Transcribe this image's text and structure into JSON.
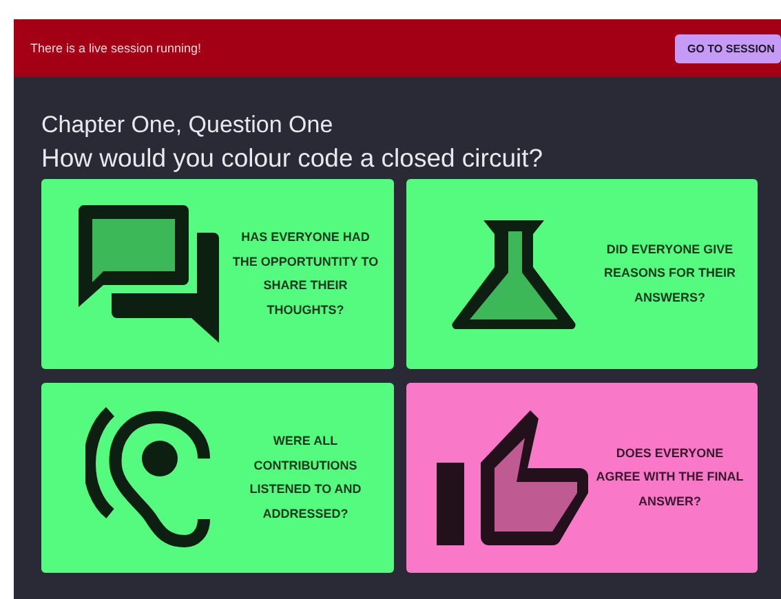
{
  "banner": {
    "message": "There is a live session running!",
    "button": "GO TO SESSION"
  },
  "chapter": "Chapter One, Question One",
  "question": "How would you colour code a closed circuit?",
  "cards": [
    {
      "kind": "chat",
      "color": "#55fb7e",
      "text": "HAS EVERYONE HAD THE OPPORTUNTITY TO SHARE THEIR THOUGHTS?"
    },
    {
      "kind": "flask",
      "color": "#55fb7e",
      "text": "DID EVERYONE GIVE REASONS FOR THEIR ANSWERS?"
    },
    {
      "kind": "ear",
      "color": "#55fb7e",
      "text": "WERE ALL CONTRIBUTIONS LISTENED TO AND ADDRESSED?"
    },
    {
      "kind": "thumb",
      "color": "#fa78c8",
      "text": "DOES EVERYONE AGREE WITH THE FINAL ANSWER?"
    }
  ]
}
